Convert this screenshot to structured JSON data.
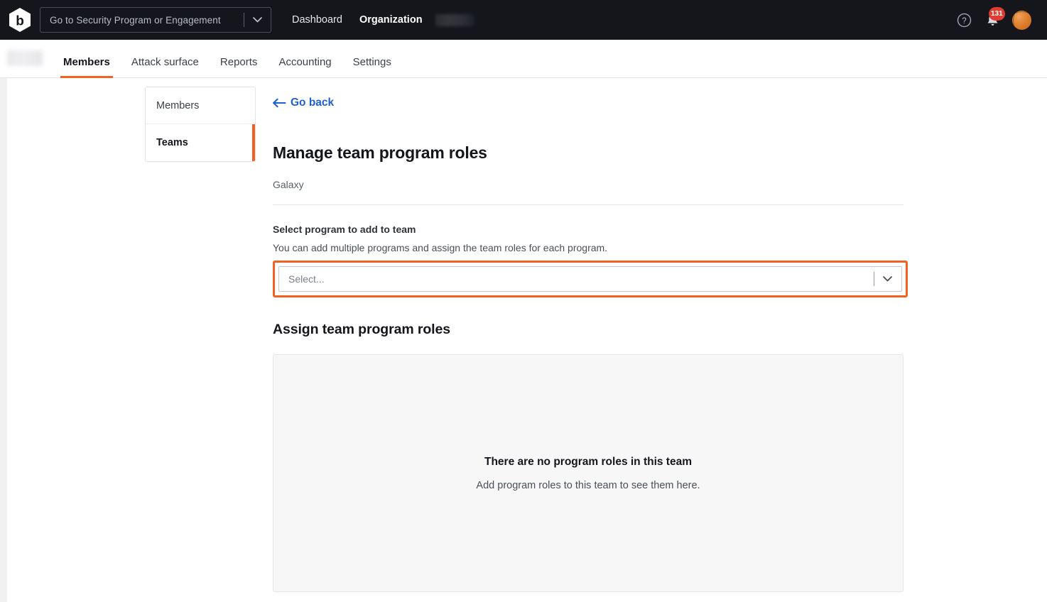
{
  "topbar": {
    "logo_icon": "bugcrowd-hexagon-b-logo",
    "program_search": {
      "placeholder": "Go to Security Program or Engagement",
      "chevron_icon": "chevron-down-icon"
    },
    "nav": [
      {
        "label": "Dashboard",
        "bold": false
      },
      {
        "label": "Organization",
        "bold": true
      }
    ],
    "org_name_redacted": "",
    "help_icon": "question-mark-circle-icon",
    "notifications_icon": "bell-icon",
    "notifications_count": "131",
    "avatar_icon": "user-avatar"
  },
  "tabs": {
    "org_logo_redacted": "",
    "items": [
      {
        "label": "Members",
        "active": true
      },
      {
        "label": "Attack surface",
        "active": false
      },
      {
        "label": "Reports",
        "active": false
      },
      {
        "label": "Accounting",
        "active": false
      },
      {
        "label": "Settings",
        "active": false
      }
    ]
  },
  "subnav": {
    "items": [
      {
        "label": "Members",
        "active": false
      },
      {
        "label": "Teams",
        "active": true
      }
    ]
  },
  "main": {
    "go_back_label": "Go back",
    "go_back_icon": "arrow-left-icon",
    "page_title": "Manage team program roles",
    "team_name": "Galaxy",
    "select_field": {
      "label": "Select program to add to team",
      "help": "You can add multiple programs and assign the team roles for each program.",
      "placeholder": "Select...",
      "value": "",
      "chevron_icon": "chevron-down-icon"
    },
    "assign_section_title": "Assign team program roles",
    "empty_state": {
      "title": "There are no program roles in this team",
      "subtitle": "Add program roles to this team to see them here."
    }
  },
  "colors": {
    "accent_orange": "#f26122",
    "link_blue": "#1f5fd6",
    "topbar_dark": "#14161c",
    "badge_red": "#e03c31",
    "panel_gray": "#f7f7f8"
  }
}
